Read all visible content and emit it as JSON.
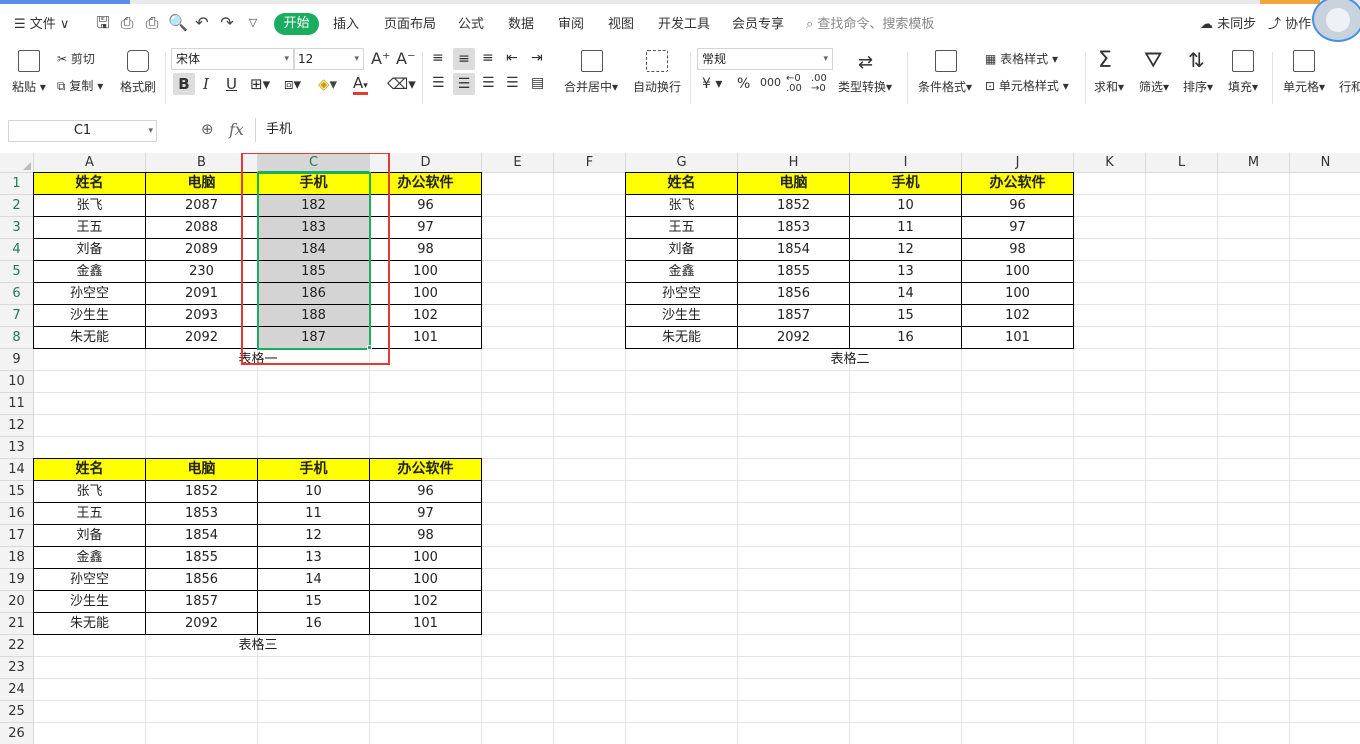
{
  "menubar": {
    "file_label": "☰ 文件 ∨",
    "tabs": [
      {
        "label": "开始",
        "active": true
      },
      {
        "label": "插入"
      },
      {
        "label": "页面布局"
      },
      {
        "label": "公式"
      },
      {
        "label": "数据"
      },
      {
        "label": "审阅"
      },
      {
        "label": "视图"
      },
      {
        "label": "开发工具"
      },
      {
        "label": "会员专享"
      }
    ],
    "search_placeholder": "查找命令、搜索模板",
    "sync_status": "未同步",
    "collab_label": "协作"
  },
  "ribbon": {
    "paste": "粘贴",
    "cut": "剪切",
    "copy": "复制",
    "format_painter": "格式刷",
    "font_name": "宋体",
    "font_size": "12",
    "bold": "B",
    "italic": "I",
    "underline": "U",
    "merge_center": "合并居中",
    "wrap_text": "自动换行",
    "number_format": "常规",
    "currency": "¥",
    "percent": "%",
    "thousands": "000",
    "type_convert": "类型转换",
    "conditional_format": "条件格式",
    "table_style": "表格样式",
    "cell_style": "单元格样式",
    "sum": "求和",
    "filter": "筛选",
    "sort": "排序",
    "fill": "填充",
    "cell": "单元格",
    "row_col": "行和"
  },
  "formula_bar": {
    "name_box": "C1",
    "fx": "fx",
    "value": "手机"
  },
  "sheet": {
    "columns": [
      "A",
      "B",
      "C",
      "D",
      "E",
      "F",
      "G",
      "H",
      "I",
      "J",
      "K",
      "L",
      "M",
      "N"
    ],
    "active_column": "C",
    "rows": [
      "1",
      "2",
      "3",
      "4",
      "5",
      "6",
      "7",
      "8",
      "9",
      "10",
      "11",
      "12",
      "13",
      "14",
      "15",
      "16",
      "17",
      "18",
      "19",
      "20",
      "21",
      "22",
      "23",
      "24",
      "25",
      "26"
    ],
    "accent_color": "#1aad60",
    "highlight_color": "#ffff00",
    "annotation_color": "#e53935",
    "table1": {
      "headers": [
        "姓名",
        "电脑",
        "手机",
        "办公软件"
      ],
      "rows": [
        [
          "张飞",
          "2087",
          "182",
          "96"
        ],
        [
          "王五",
          "2088",
          "183",
          "97"
        ],
        [
          "刘备",
          "2089",
          "184",
          "98"
        ],
        [
          "金鑫",
          "230",
          "185",
          "100"
        ],
        [
          "孙空空",
          "2091",
          "186",
          "100"
        ],
        [
          "沙生生",
          "2093",
          "188",
          "102"
        ],
        [
          "朱无能",
          "2092",
          "187",
          "101"
        ]
      ],
      "caption": "表格一"
    },
    "table2": {
      "headers": [
        "姓名",
        "电脑",
        "手机",
        "办公软件"
      ],
      "rows": [
        [
          "张飞",
          "1852",
          "10",
          "96"
        ],
        [
          "王五",
          "1853",
          "11",
          "97"
        ],
        [
          "刘备",
          "1854",
          "12",
          "98"
        ],
        [
          "金鑫",
          "1855",
          "13",
          "100"
        ],
        [
          "孙空空",
          "1856",
          "14",
          "100"
        ],
        [
          "沙生生",
          "1857",
          "15",
          "102"
        ],
        [
          "朱无能",
          "2092",
          "16",
          "101"
        ]
      ],
      "caption": "表格二"
    },
    "table3": {
      "headers": [
        "姓名",
        "电脑",
        "手机",
        "办公软件"
      ],
      "rows": [
        [
          "张飞",
          "1852",
          "10",
          "96"
        ],
        [
          "王五",
          "1853",
          "11",
          "97"
        ],
        [
          "刘备",
          "1854",
          "12",
          "98"
        ],
        [
          "金鑫",
          "1855",
          "13",
          "100"
        ],
        [
          "孙空空",
          "1856",
          "14",
          "100"
        ],
        [
          "沙生生",
          "1857",
          "15",
          "102"
        ],
        [
          "朱无能",
          "2092",
          "16",
          "101"
        ]
      ],
      "caption": "表格三"
    }
  }
}
